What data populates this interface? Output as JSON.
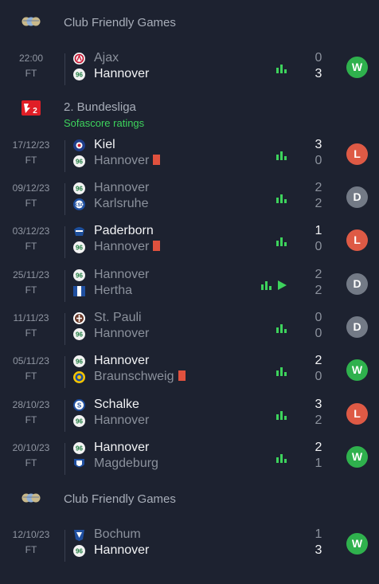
{
  "colors": {
    "background": "#1d2230",
    "win_badge": "#2fb14d",
    "loss_badge": "#de5a45",
    "draw_badge": "#737a86",
    "stats_icon": "#3dd35c",
    "red_card": "#e0513e"
  },
  "sections": [
    {
      "title": "Club Friendly Games",
      "subtitle": "",
      "icon": "globe-trophy-icon",
      "matches": [
        {
          "date": "22:00",
          "status": "FT",
          "home": {
            "name": "Ajax",
            "crest": "ajax-crest-icon",
            "red_card": false
          },
          "away": {
            "name": "Hannover",
            "crest": "hannover-crest-icon",
            "red_card": false
          },
          "home_score": "0",
          "away_score": "3",
          "winner": "away",
          "result": "W",
          "has_video": false
        }
      ]
    },
    {
      "title": "2. Bundesliga",
      "subtitle": "Sofascore ratings",
      "icon": "bundesliga-2-icon",
      "matches": [
        {
          "date": "17/12/23",
          "status": "FT",
          "home": {
            "name": "Kiel",
            "crest": "kiel-crest-icon",
            "red_card": false
          },
          "away": {
            "name": "Hannover",
            "crest": "hannover-crest-icon",
            "red_card": true
          },
          "home_score": "3",
          "away_score": "0",
          "winner": "home",
          "result": "L",
          "has_video": false
        },
        {
          "date": "09/12/23",
          "status": "FT",
          "home": {
            "name": "Hannover",
            "crest": "hannover-crest-icon",
            "red_card": false
          },
          "away": {
            "name": "Karlsruhe",
            "crest": "karlsruhe-crest-icon",
            "red_card": false
          },
          "home_score": "2",
          "away_score": "2",
          "winner": "none",
          "result": "D",
          "has_video": false
        },
        {
          "date": "03/12/23",
          "status": "FT",
          "home": {
            "name": "Paderborn",
            "crest": "paderborn-crest-icon",
            "red_card": false
          },
          "away": {
            "name": "Hannover",
            "crest": "hannover-crest-icon",
            "red_card": true
          },
          "home_score": "1",
          "away_score": "0",
          "winner": "home",
          "result": "L",
          "has_video": false
        },
        {
          "date": "25/11/23",
          "status": "FT",
          "home": {
            "name": "Hannover",
            "crest": "hannover-crest-icon",
            "red_card": false
          },
          "away": {
            "name": "Hertha",
            "crest": "hertha-crest-icon",
            "red_card": false
          },
          "home_score": "2",
          "away_score": "2",
          "winner": "none",
          "result": "D",
          "has_video": true
        },
        {
          "date": "11/11/23",
          "status": "FT",
          "home": {
            "name": "St. Pauli",
            "crest": "st-pauli-crest-icon",
            "red_card": false
          },
          "away": {
            "name": "Hannover",
            "crest": "hannover-crest-icon",
            "red_card": false
          },
          "home_score": "0",
          "away_score": "0",
          "winner": "none",
          "result": "D",
          "has_video": false
        },
        {
          "date": "05/11/23",
          "status": "FT",
          "home": {
            "name": "Hannover",
            "crest": "hannover-crest-icon",
            "red_card": false
          },
          "away": {
            "name": "Braunschweig",
            "crest": "braunschweig-crest-icon",
            "red_card": true
          },
          "home_score": "2",
          "away_score": "0",
          "winner": "home",
          "result": "W",
          "has_video": false
        },
        {
          "date": "28/10/23",
          "status": "FT",
          "home": {
            "name": "Schalke",
            "crest": "schalke-crest-icon",
            "red_card": false
          },
          "away": {
            "name": "Hannover",
            "crest": "hannover-crest-icon",
            "red_card": false
          },
          "home_score": "3",
          "away_score": "2",
          "winner": "home",
          "result": "L",
          "has_video": false
        },
        {
          "date": "20/10/23",
          "status": "FT",
          "home": {
            "name": "Hannover",
            "crest": "hannover-crest-icon",
            "red_card": false
          },
          "away": {
            "name": "Magdeburg",
            "crest": "magdeburg-crest-icon",
            "red_card": false
          },
          "home_score": "2",
          "away_score": "1",
          "winner": "home",
          "result": "W",
          "has_video": false
        }
      ]
    },
    {
      "title": "Club Friendly Games",
      "subtitle": "",
      "icon": "globe-trophy-icon",
      "matches": [
        {
          "date": "12/10/23",
          "status": "FT",
          "home": {
            "name": "Bochum",
            "crest": "bochum-crest-icon",
            "red_card": false
          },
          "away": {
            "name": "Hannover",
            "crest": "hannover-crest-icon",
            "red_card": false
          },
          "home_score": "1",
          "away_score": "3",
          "winner": "away",
          "result": "W",
          "has_video": false
        }
      ]
    }
  ]
}
